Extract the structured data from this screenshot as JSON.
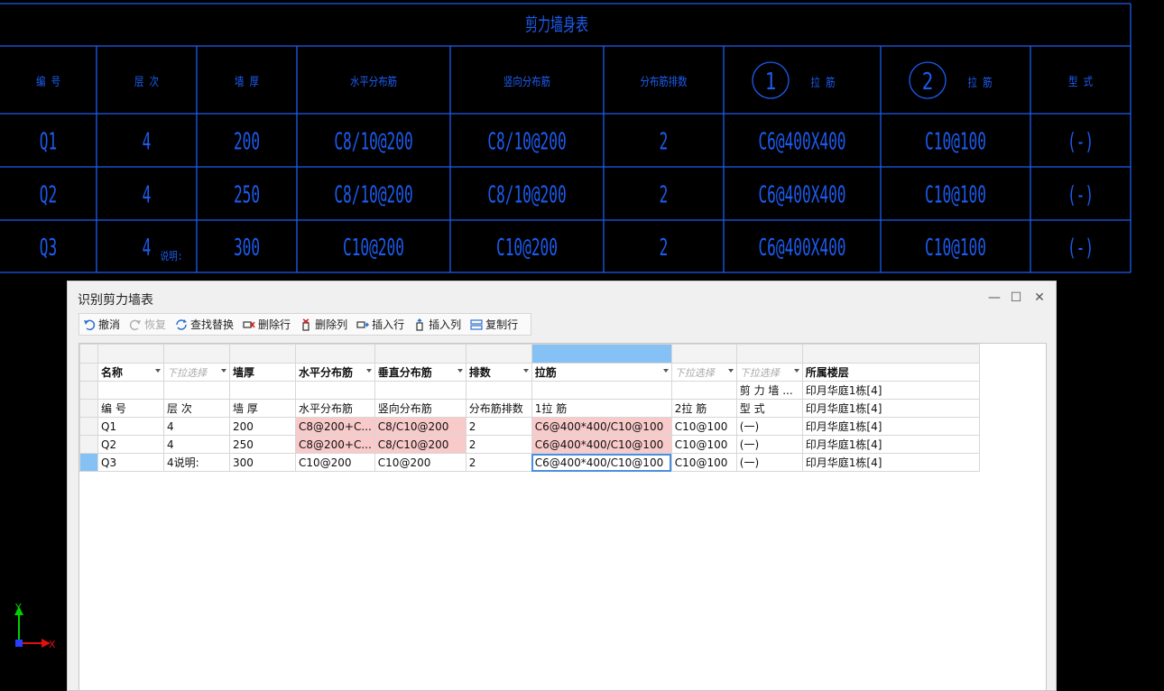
{
  "cad_table": {
    "title": "剪力墙身表",
    "headers": [
      "编 号",
      "层 次",
      "墙 厚",
      "水平分布筋",
      "竖向分布筋",
      "分布筋排数",
      "",
      "",
      "型 式"
    ],
    "header_circles": [
      {
        "num": "1",
        "label": "拉 筋"
      },
      {
        "num": "2",
        "label": "拉 筋"
      }
    ],
    "rows": [
      [
        "Q1",
        "4",
        "200",
        "C8/10@200",
        "C8/10@200",
        "2",
        "C6@400X400",
        "C10@100",
        "(-)"
      ],
      [
        "Q2",
        "4",
        "250",
        "C8/10@200",
        "C8/10@200",
        "2",
        "C6@400X400",
        "C10@100",
        "(-)"
      ],
      [
        "Q3",
        "4",
        "300",
        "C10@200",
        "C10@200",
        "2",
        "C6@400X400",
        "C10@100",
        "(-)"
      ]
    ],
    "note": "说明:",
    "line_color": "#1c5cf0"
  },
  "dialog": {
    "title": "识别剪力墙表",
    "window_buttons": [
      "—",
      "☐",
      "✕"
    ],
    "toolbar": [
      {
        "label": "撤消",
        "icon": "undo-icon",
        "enabled": true
      },
      {
        "label": "恢复",
        "icon": "redo-icon",
        "enabled": false
      },
      {
        "label": "查找替换",
        "icon": "find-replace-icon",
        "enabled": true
      },
      {
        "label": "删除行",
        "icon": "delete-row-icon",
        "enabled": true
      },
      {
        "label": "删除列",
        "icon": "delete-column-icon",
        "enabled": true
      },
      {
        "label": "插入行",
        "icon": "insert-row-icon",
        "enabled": true
      },
      {
        "label": "插入列",
        "icon": "insert-column-icon",
        "enabled": true
      },
      {
        "label": "复制行",
        "icon": "copy-row-icon",
        "enabled": true
      }
    ]
  },
  "grid": {
    "selected_column": 6,
    "selected_row": 5,
    "dropdowns": [
      {
        "label": "名称",
        "placeholder": false
      },
      {
        "label": "下拉选择",
        "placeholder": true
      },
      {
        "label": "墙厚",
        "placeholder": false,
        "no_arrow": true
      },
      {
        "label": "水平分布筋",
        "placeholder": false
      },
      {
        "label": "垂直分布筋",
        "placeholder": false
      },
      {
        "label": "排数",
        "placeholder": false
      },
      {
        "label": "拉筋",
        "placeholder": false
      },
      {
        "label": "下拉选择",
        "placeholder": true
      },
      {
        "label": "下拉选择",
        "placeholder": true
      },
      {
        "label": "所属楼层",
        "placeholder": false,
        "no_arrow": true
      }
    ],
    "rows": [
      [
        "",
        "",
        "",
        "",
        "",
        "",
        "",
        "",
        "剪 力 墙 ...",
        "印月华庭1栋[4]"
      ],
      [
        "编 号",
        "层 次",
        "墙 厚",
        "水平分布筋",
        "竖向分布筋",
        "分布筋排数",
        "1拉 筋",
        "2拉 筋",
        "型 式",
        "印月华庭1栋[4]"
      ],
      [
        "Q1",
        "4",
        "200",
        "C8@200+C...",
        "C8/C10@200",
        "2",
        "C6@400*400/C10@100",
        "C10@100",
        "(一)",
        "印月华庭1栋[4]"
      ],
      [
        "Q2",
        "4",
        "250",
        "C8@200+C...",
        "C8/C10@200",
        "2",
        "C6@400*400/C10@100",
        "C10@100",
        "(一)",
        "印月华庭1栋[4]"
      ],
      [
        "Q3",
        "4说明:",
        "300",
        "C10@200",
        "C10@200",
        "2",
        "C6@400*400/C10@100",
        "C10@100",
        "(一)",
        "印月华庭1栋[4]"
      ]
    ],
    "pink_cells": [
      [
        2,
        3
      ],
      [
        2,
        4
      ],
      [
        2,
        6
      ],
      [
        3,
        3
      ],
      [
        3,
        4
      ],
      [
        3,
        6
      ]
    ],
    "focus_cell": [
      4,
      6
    ],
    "pink_color": "#f8caca",
    "selection_color": "#86c1f5"
  },
  "axis": {
    "y_label": "Y",
    "x_label": "X"
  }
}
